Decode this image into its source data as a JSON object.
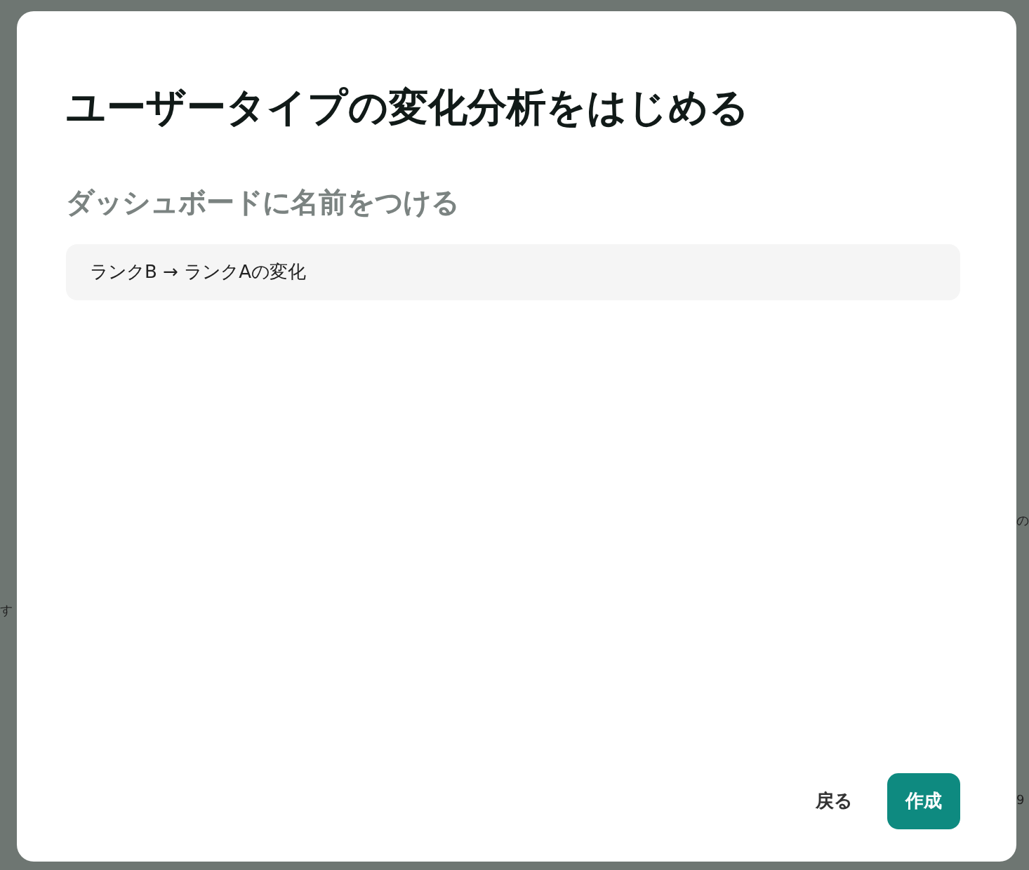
{
  "backdrop": {
    "left_fragments": [
      "す"
    ],
    "right_fragments": [
      "の",
      "9"
    ]
  },
  "dialog": {
    "title": "ユーザータイプの変化分析をはじめる",
    "subtitle": "ダッシュボードに名前をつける",
    "name_field": {
      "value": "ランクB → ランクAの変化"
    },
    "buttons": [
      {
        "label": "戻る",
        "kind": "text"
      },
      {
        "label": "作成",
        "kind": "primary"
      }
    ]
  }
}
